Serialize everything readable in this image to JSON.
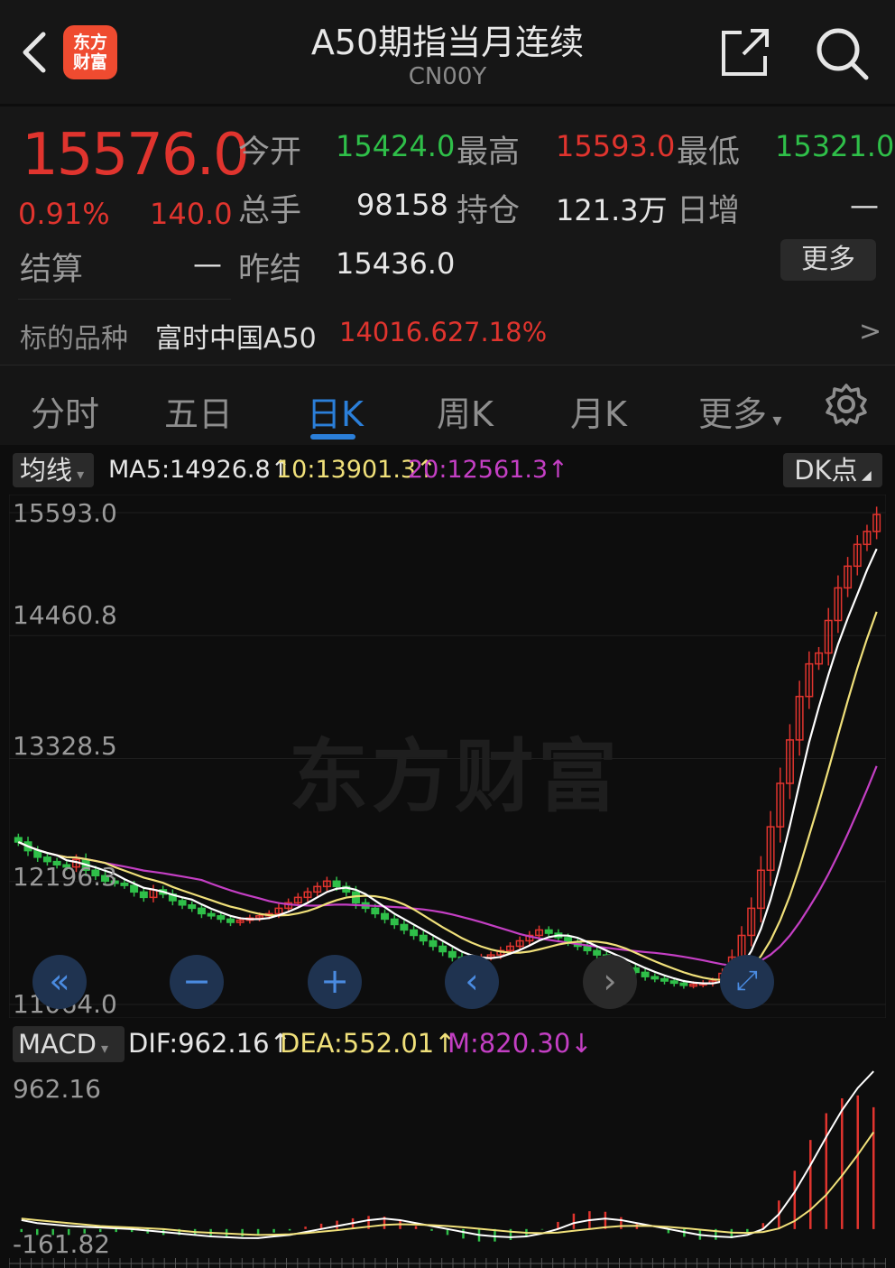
{
  "header": {
    "title": "A50期指当月连续",
    "code": "CN00Y",
    "logo_line1": "东方",
    "logo_line2": "财富"
  },
  "quote": {
    "price": "15576.0",
    "change_pct": "0.91%",
    "change": "140.0",
    "open_label": "今开",
    "open": "15424.0",
    "high_label": "最高",
    "high": "15593.0",
    "low_label": "最低",
    "low": "15321.0",
    "volume_label": "总手",
    "volume": "98158",
    "oi_label": "持仓",
    "oi": "121.3万",
    "daily_inc_label": "日增",
    "daily_inc": "—",
    "settle_label": "结算",
    "settle": "—",
    "prev_settle_label": "昨结",
    "prev_settle": "15436.0",
    "more_label": "更多",
    "underlying_label": "标的品种",
    "underlying_name": "富时中国A50",
    "underlying_price": "14016.62",
    "underlying_pct": "7.18%",
    "arrow": ">"
  },
  "tabs": [
    {
      "label": "分时"
    },
    {
      "label": "五日"
    },
    {
      "label": "日K"
    },
    {
      "label": "周K"
    },
    {
      "label": "月K"
    },
    {
      "label": "更多"
    }
  ],
  "legend": {
    "ma_select": "均线",
    "ma5": "MA5:14926.8",
    "ma10": "10:13901.3",
    "ma20": "20:12561.3",
    "dk": "DK点"
  },
  "macd_legend": {
    "select": "MACD",
    "dif": "DIF:962.16",
    "dea": "DEA:552.01",
    "m": "M:820.30"
  },
  "watermark": "东方财富",
  "colors": {
    "up": "#e0342e",
    "down": "#2fbf49",
    "ma5": "#ffffff",
    "ma10": "#f0e07a",
    "ma20": "#c43fc4",
    "accent": "#2b7fd9"
  },
  "chart_data": [
    {
      "type": "candlestick",
      "title": "",
      "ylim": [
        11064.0,
        15593.0
      ],
      "ytick_labels": [
        "15593.0",
        "14460.8",
        "13328.5",
        "12196.3",
        "11064.0"
      ],
      "closes": [
        12560,
        12480,
        12420,
        12380,
        12350,
        12330,
        12400,
        12300,
        12250,
        12200,
        12180,
        12160,
        12100,
        12050,
        12120,
        12080,
        12020,
        11980,
        11950,
        11900,
        11880,
        11850,
        11820,
        11840,
        11860,
        11880,
        11900,
        11950,
        12000,
        12050,
        12100,
        12150,
        12200,
        12150,
        12100,
        12000,
        11950,
        11900,
        11850,
        11800,
        11750,
        11700,
        11650,
        11600,
        11550,
        11500,
        11450,
        11480,
        11500,
        11520,
        11560,
        11600,
        11650,
        11700,
        11750,
        11720,
        11680,
        11640,
        11600,
        11560,
        11520,
        11480,
        11440,
        11400,
        11360,
        11320,
        11300,
        11280,
        11260,
        11240,
        11250,
        11260,
        11280,
        11350,
        11500,
        11700,
        11950,
        12300,
        12700,
        13100,
        13500,
        13900,
        14200,
        14300,
        14600,
        14900,
        15100,
        15300,
        15420,
        15576
      ]
    },
    {
      "type": "line",
      "title": "",
      "ytick_labels": [
        "962.16",
        "-161.82"
      ],
      "series": [
        {
          "name": "DIF",
          "values": [
            -40,
            -60,
            -70,
            -80,
            -85,
            -90,
            -95,
            -100,
            -110,
            -120,
            -130,
            -140,
            -150,
            -155,
            -160,
            -161,
            -150,
            -140,
            -120,
            -100,
            -80,
            -60,
            -40,
            -30,
            -40,
            -60,
            -80,
            -100,
            -120,
            -140,
            -150,
            -155,
            -150,
            -130,
            -100,
            -60,
            -40,
            -30,
            -40,
            -60,
            -80,
            -100,
            -120,
            -140,
            -150,
            -155,
            -140,
            -100,
            0,
            150,
            330,
            520,
            700,
            850,
            962
          ]
        },
        {
          "name": "DEA",
          "values": [
            -30,
            -40,
            -50,
            -60,
            -70,
            -80,
            -85,
            -90,
            -95,
            -100,
            -110,
            -120,
            -125,
            -130,
            -135,
            -140,
            -138,
            -135,
            -128,
            -118,
            -108,
            -96,
            -84,
            -72,
            -68,
            -70,
            -74,
            -80,
            -88,
            -98,
            -108,
            -118,
            -125,
            -128,
            -124,
            -112,
            -100,
            -88,
            -80,
            -78,
            -80,
            -86,
            -94,
            -104,
            -114,
            -124,
            -126,
            -120,
            -96,
            -46,
            30,
            130,
            260,
            400,
            552
          ]
        }
      ]
    }
  ]
}
